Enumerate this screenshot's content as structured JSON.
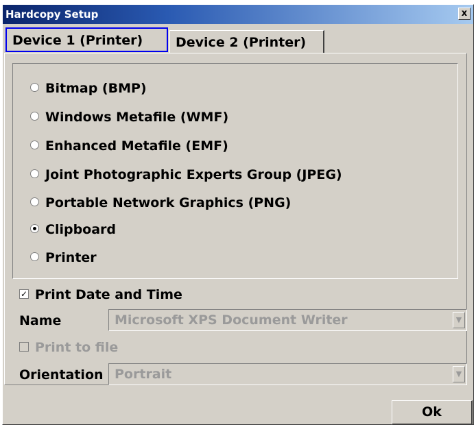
{
  "window": {
    "title": "Hardcopy Setup",
    "close_label": "x"
  },
  "tabs": [
    {
      "label": "Device 1 (Printer)",
      "active": true
    },
    {
      "label": "Device 2 (Printer)",
      "active": false
    }
  ],
  "formats": {
    "options": [
      {
        "label": "Bitmap (BMP)",
        "checked": false
      },
      {
        "label": "Windows Metafile (WMF)",
        "checked": false
      },
      {
        "label": "Enhanced Metafile (EMF)",
        "checked": false
      },
      {
        "label": "Joint Photographic Experts Group (JPEG)",
        "checked": false
      },
      {
        "label": "Portable Network Graphics (PNG)",
        "checked": false
      },
      {
        "label": "Clipboard",
        "checked": true
      },
      {
        "label": "Printer",
        "checked": false
      }
    ]
  },
  "print_date_time": {
    "label": "Print Date and Time",
    "checked": true
  },
  "name": {
    "label": "Name",
    "value": "Microsoft XPS Document Writer"
  },
  "print_to_file": {
    "label": "Print to file",
    "checked": false,
    "disabled": true
  },
  "orientation": {
    "label": "Orientation",
    "value": "Portrait"
  },
  "ok_label": "Ok"
}
